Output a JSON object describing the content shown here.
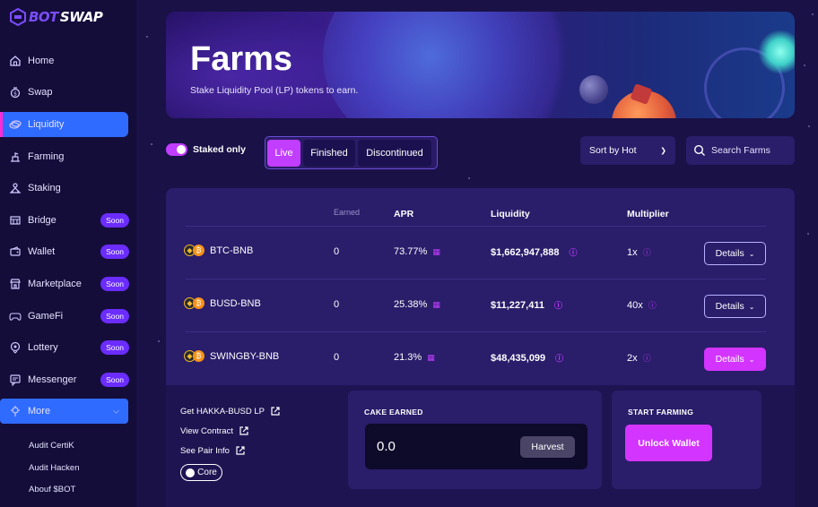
{
  "app": {
    "logo_bot": "BOT",
    "logo_swap": "SWAP"
  },
  "sidebar": {
    "items": [
      {
        "label": "Home",
        "icon": "home-icon"
      },
      {
        "label": "Swap",
        "icon": "swap-icon"
      },
      {
        "label": "Liquidity",
        "icon": "liquidity-icon",
        "active": true
      },
      {
        "label": "Farming",
        "icon": "farming-icon"
      },
      {
        "label": "Staking",
        "icon": "staking-icon"
      },
      {
        "label": "Bridge",
        "icon": "bridge-icon",
        "badge": "Soon"
      },
      {
        "label": "Wallet",
        "icon": "wallet-icon",
        "badge": "Soon"
      },
      {
        "label": "Marketplace",
        "icon": "marketplace-icon",
        "badge": "Soon"
      },
      {
        "label": "GameFi",
        "icon": "gamefi-icon",
        "badge": "Soon"
      },
      {
        "label": "Lottery",
        "icon": "lottery-icon",
        "badge": "Soon"
      },
      {
        "label": "Messenger",
        "icon": "messenger-icon",
        "badge": "Soon"
      }
    ],
    "more_label": "More",
    "sub_items": [
      "Audit CertiK",
      "Audit Hacken",
      "Abouf $BOT"
    ]
  },
  "banner": {
    "title": "Farms",
    "subtitle": "Stake Liquidity Pool (LP) tokens to earn."
  },
  "filters": {
    "staked_only": "Staked only",
    "tabs": [
      "Live",
      "Finished",
      "Discontinued"
    ],
    "sort_label": "Sort by Hot",
    "search_placeholder": "Search Farms"
  },
  "table": {
    "headers": {
      "earned": "Earned",
      "apr": "APR",
      "liquidity": "Liquidity",
      "multiplier": "Multiplier"
    },
    "rows": [
      {
        "pair": "BTC-BNB",
        "earned": "0",
        "apr": "73.77%",
        "liquidity": "$1,662,947,888",
        "multiplier": "1x",
        "details": "Details"
      },
      {
        "pair": "BUSD-BNB",
        "earned": "0",
        "apr": "25.38%",
        "liquidity": "$11,227,411",
        "multiplier": "40x",
        "details": "Details"
      },
      {
        "pair": "SWINGBY-BNB",
        "earned": "0",
        "apr": "21.3%",
        "liquidity": "$48,435,099",
        "multiplier": "2x",
        "details": "Details"
      }
    ]
  },
  "expanded": {
    "links": [
      "Get HAKKA-BUSD LP",
      "View Contract",
      "See Pair Info"
    ],
    "core_label": "Core",
    "cake_title": "CAKE EARNED",
    "cake_value": "0.0",
    "harvest_label": "Harvest",
    "farming_title": "START FARMING",
    "unlock_label": "Unlock Wallet"
  },
  "colors": {
    "accent": "#c13dff",
    "active_nav": "#2f6bff",
    "badge": "#6b2cff",
    "bg": "#1a1147",
    "panel": "#2a1d6a"
  }
}
